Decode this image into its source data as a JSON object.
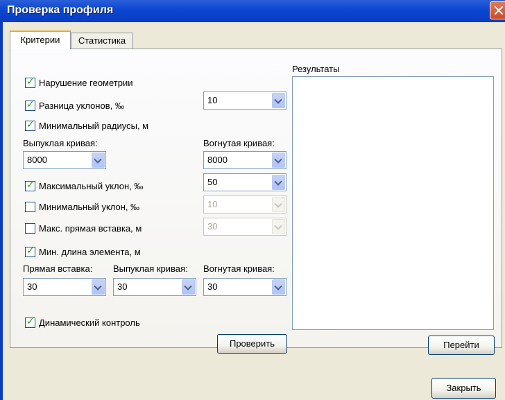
{
  "window": {
    "title": "Проверка профиля"
  },
  "tabs": [
    {
      "label": "Критерии"
    },
    {
      "label": "Статистика"
    }
  ],
  "criteria": {
    "geometry_violation": {
      "label": "Нарушение геометрии",
      "checked": true
    },
    "slope_difference": {
      "label": "Разница уклонов, ‰",
      "checked": true,
      "value": "10"
    },
    "min_radii": {
      "label": "Минимальный радиусы, м",
      "checked": true
    },
    "convex_label": "Выпуклая кривая:",
    "concave_label": "Вогнутая кривая:",
    "convex_value": "8000",
    "concave_value": "8000",
    "max_slope": {
      "label": "Максимальный уклон, ‰",
      "checked": true,
      "value": "50"
    },
    "min_slope": {
      "label": "Минимальный уклон, ‰",
      "checked": false,
      "value": "10"
    },
    "max_straight": {
      "label": "Макс. прямая вставка, м",
      "checked": false,
      "value": "30"
    },
    "min_element_length": {
      "label": "Мин. длина элемента, м",
      "checked": true
    },
    "straight_label": "Прямая вставка:",
    "convex2_label": "Выпуклая кривая:",
    "concave2_label": "Вогнутая кривая:",
    "straight_value": "30",
    "convex2_value": "30",
    "concave2_value": "30",
    "dynamic_control": {
      "label": "Динамический контроль",
      "checked": true
    }
  },
  "results": {
    "label": "Результаты"
  },
  "buttons": {
    "check": "Проверить",
    "goto": "Перейти",
    "close": "Закрыть"
  }
}
